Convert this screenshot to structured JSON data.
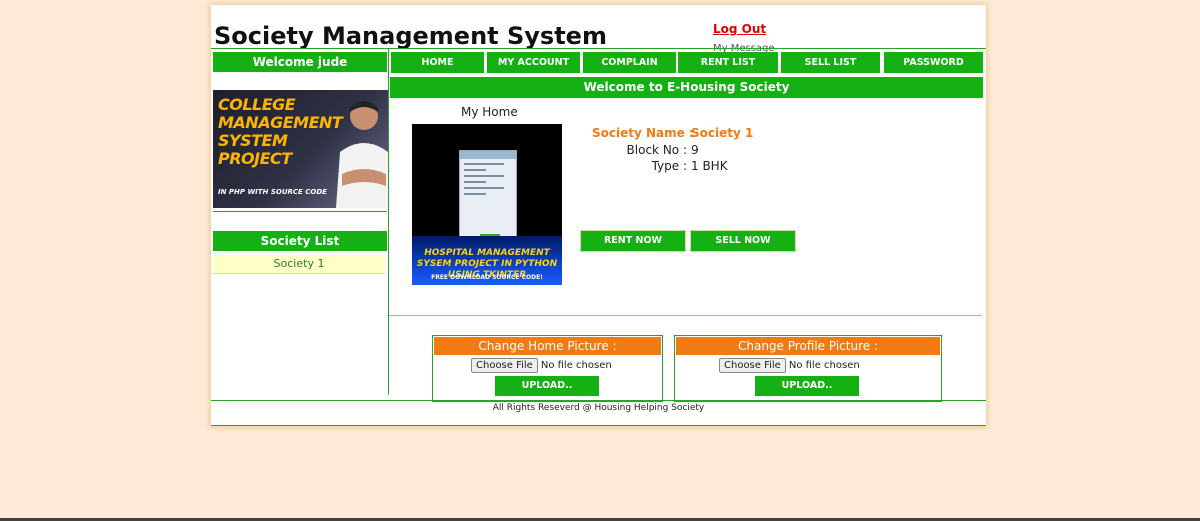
{
  "header": {
    "title": "Society Management System",
    "logout_label": "Log Out",
    "message_label": "My Message"
  },
  "sidebar": {
    "welcome": "Welcome jude",
    "promo": {
      "headline": "COLLEGE MANAGEMENT SYSTEM PROJECT",
      "subline": "IN PHP WITH SOURCE CODE"
    },
    "society_list_title": "Society List",
    "societies": [
      "Society 1"
    ]
  },
  "nav": {
    "items": [
      "HOME",
      "MY ACCOUNT",
      "COMPLAIN",
      "RENT LIST",
      "SELL LIST",
      "PASSWORD"
    ]
  },
  "main": {
    "heading": "Welcome to E-Housing Society",
    "home_label": "My Home",
    "home_picture": {
      "headline": "HOSPITAL MANAGEMENT SYSEM PROJECT IN PYTHON USING TKINTER",
      "subline": "FREE DOWNLOAD SOURCE CODE!"
    },
    "details": {
      "society_name_label": "Society Name :",
      "society_name_value": "Society 1",
      "block_label": "Block No :",
      "block_value": "9",
      "type_label": "Type :",
      "type_value": "1 BHK"
    },
    "rent_button": "RENT NOW",
    "sell_button": "SELL NOW",
    "home_upload": {
      "title": "Change Home Picture :",
      "choose_label": "Choose File",
      "file_status": "No file chosen",
      "upload_label": "UPLOAD.."
    },
    "profile_upload": {
      "title": "Change Profile Picture :",
      "choose_label": "Choose File",
      "file_status": "No file chosen",
      "upload_label": "UPLOAD.."
    }
  },
  "footer": {
    "text": "All Rights Reseverd @ Housing Helping Society"
  },
  "colors": {
    "background": "#fdebd8",
    "green": "#14b014",
    "orange": "#f07a14",
    "logout": "#e00000"
  }
}
